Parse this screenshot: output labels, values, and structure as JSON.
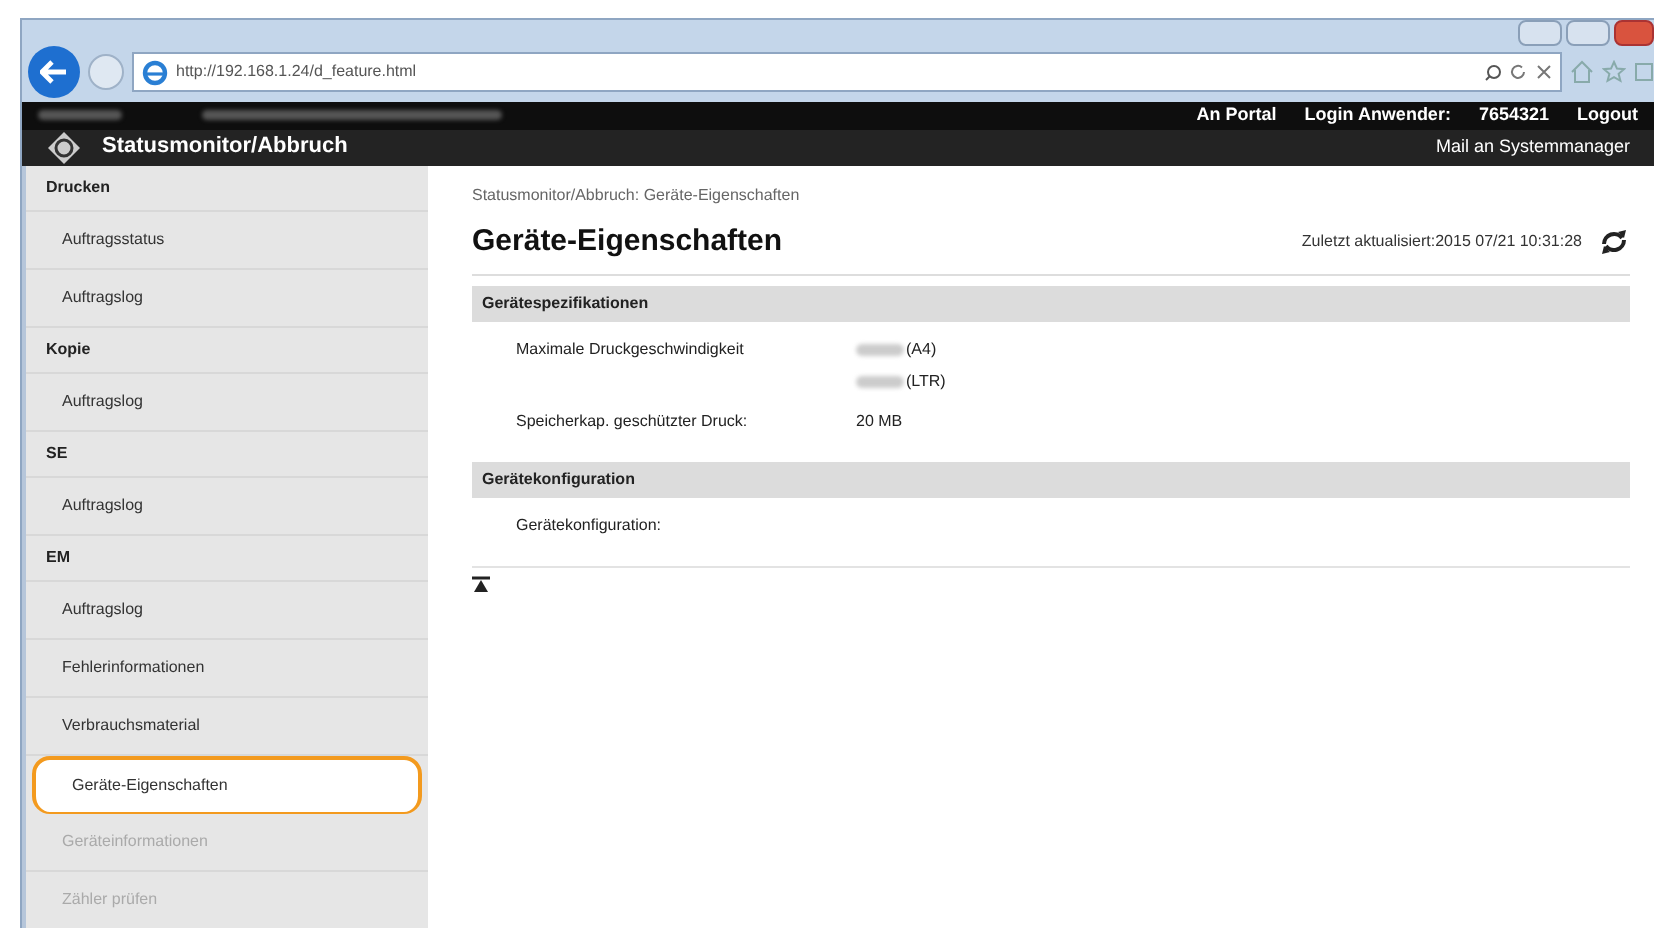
{
  "browser": {
    "address": "http://192.168.1.24/d_feature.html"
  },
  "top_bar": {
    "links": [
      "An Portal",
      "Login Anwender:",
      "7654321",
      "Logout"
    ]
  },
  "header": {
    "title": "Statusmonitor/Abbruch",
    "mail_link": "Mail an Systemmanager"
  },
  "sidebar": {
    "items": [
      {
        "kind": "section",
        "label": "Drucken"
      },
      {
        "kind": "link",
        "label": "Auftragsstatus",
        "selected": false,
        "highlighted": false,
        "faded": false
      },
      {
        "kind": "link",
        "label": "Auftragslog",
        "selected": false,
        "highlighted": false,
        "faded": false
      },
      {
        "kind": "section",
        "label": "Kopie"
      },
      {
        "kind": "link",
        "label": "Auftragslog",
        "selected": false,
        "highlighted": false,
        "faded": false
      },
      {
        "kind": "section",
        "label": "SE"
      },
      {
        "kind": "link",
        "label": "Auftragslog",
        "selected": false,
        "highlighted": false,
        "faded": false
      },
      {
        "kind": "section",
        "label": "EM"
      },
      {
        "kind": "link",
        "label": "Auftragslog",
        "selected": false,
        "highlighted": false,
        "faded": false
      },
      {
        "kind": "link",
        "label": "Fehlerinformationen",
        "selected": false,
        "highlighted": false,
        "faded": false
      },
      {
        "kind": "link",
        "label": "Verbrauchsmaterial",
        "selected": false,
        "highlighted": false,
        "faded": false
      },
      {
        "kind": "link",
        "label": "Geräte-Eigenschaften",
        "selected": true,
        "highlighted": true,
        "faded": false
      },
      {
        "kind": "link",
        "label": "Geräteinformationen",
        "selected": false,
        "highlighted": false,
        "faded": true
      },
      {
        "kind": "link",
        "label": "Zähler prüfen",
        "selected": false,
        "highlighted": false,
        "faded": true
      }
    ]
  },
  "content": {
    "breadcrumb": "Statusmonitor/Abbruch: Geräte-Eigenschaften",
    "title": "Geräte-Eigenschaften",
    "updated": "Zuletzt aktualisiert:2015 07/21 10:31:28",
    "sections": [
      {
        "heading": "Gerätespezifikationen",
        "rows": [
          {
            "label": "Maximale Druckgeschwindigkeit",
            "values": [
              "(A4)",
              "(LTR)"
            ],
            "redacted": true
          },
          {
            "label": "Speicherkap. geschützter Druck:",
            "values": [
              "20 MB"
            ]
          }
        ]
      },
      {
        "heading": "Gerätekonfiguration",
        "rows": [
          {
            "label": "Gerätekonfiguration:",
            "values": []
          }
        ]
      }
    ]
  }
}
